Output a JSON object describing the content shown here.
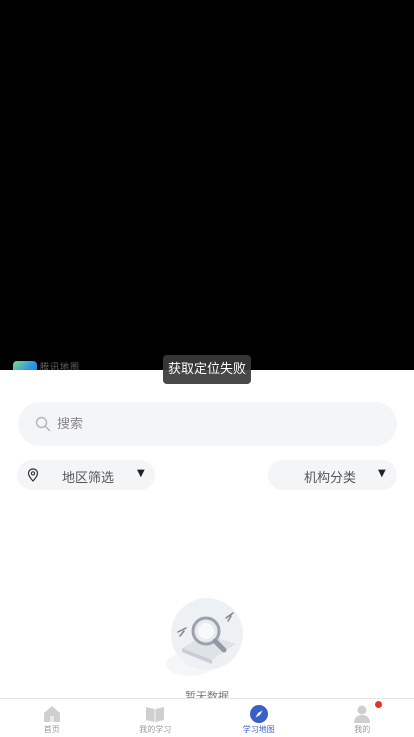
{
  "map": {
    "logo_text": "腾讯地图"
  },
  "toast": {
    "message": "获取定位失败"
  },
  "search": {
    "placeholder": "搜索",
    "value": ""
  },
  "filters": {
    "region_label": "地区筛选",
    "category_label": "机构分类",
    "caret": "▼"
  },
  "empty_state": {
    "text": "暂无数据"
  },
  "tabbar": {
    "tabs": [
      {
        "label": "首页",
        "icon": "home-icon",
        "active": false
      },
      {
        "label": "我的学习",
        "icon": "book-icon",
        "active": false
      },
      {
        "label": "学习地图",
        "icon": "compass-icon",
        "active": true
      },
      {
        "label": "我的",
        "icon": "user-icon",
        "active": false,
        "badge": true
      }
    ]
  },
  "colors": {
    "accent": "#3b5fc9",
    "badge": "#e8312b",
    "inactive_icon": "#cfcfcf",
    "field_bg": "#f4f5f7"
  }
}
